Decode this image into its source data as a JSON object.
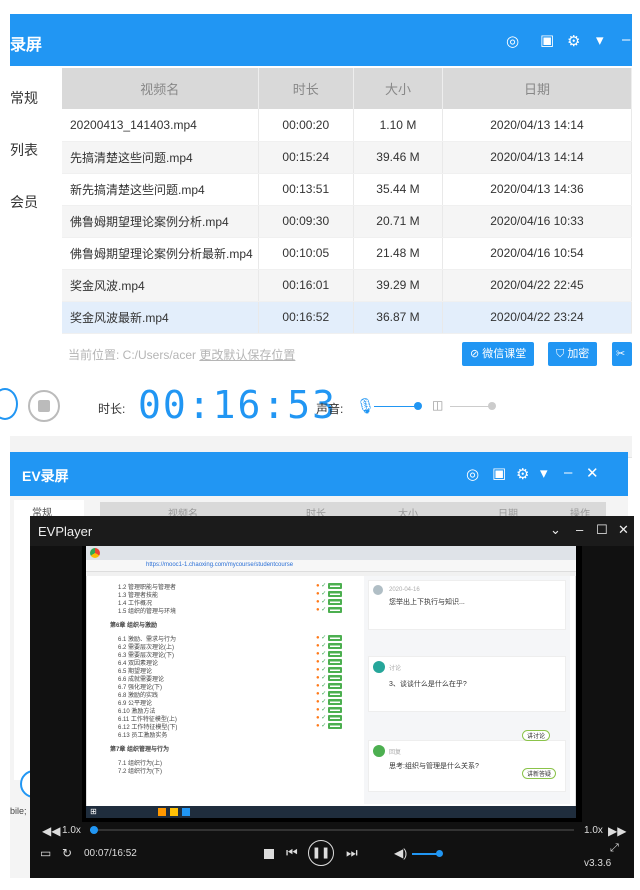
{
  "top_window": {
    "title": "录屏",
    "sidebar": [
      "常规",
      "列表",
      "会员"
    ],
    "table": {
      "headers": [
        "视频名",
        "时长",
        "大小",
        "日期"
      ],
      "rows": [
        {
          "name": "20200413_141403.mp4",
          "duration": "00:00:20",
          "size": "1.10 M",
          "date": "2020/04/13 14:14"
        },
        {
          "name": "先搞清楚这些问题.mp4",
          "duration": "00:15:24",
          "size": "39.46 M",
          "date": "2020/04/13 14:14"
        },
        {
          "name": "新先搞清楚这些问题.mp4",
          "duration": "00:13:51",
          "size": "35.44 M",
          "date": "2020/04/13 14:36"
        },
        {
          "name": "佛鲁姆期望理论案例分析.mp4",
          "duration": "00:09:30",
          "size": "20.71 M",
          "date": "2020/04/16 10:33"
        },
        {
          "name": "佛鲁姆期望理论案例分析最新.mp4",
          "duration": "00:10:05",
          "size": "21.48 M",
          "date": "2020/04/16 10:54"
        },
        {
          "name": "奖金风波.mp4",
          "duration": "00:16:01",
          "size": "39.29 M",
          "date": "2020/04/22 22:45"
        },
        {
          "name": "奖金风波最新.mp4",
          "duration": "00:16:52",
          "size": "36.87 M",
          "date": "2020/04/22 23:24"
        }
      ]
    },
    "path_label": "当前位置: C:/Users/acer",
    "path_link": "更改默认保存位置",
    "wechat_btn": "微信课堂",
    "encrypt_btn": "加密",
    "duration_label": "时长:",
    "timer": "00:16:53",
    "sound_label": "声音:"
  },
  "second_window": {
    "title": "EV录屏",
    "sidebar_item": "常规",
    "headers": [
      "视频名",
      "时长",
      "大小",
      "日期",
      "操作"
    ],
    "bottom_text": "bile;"
  },
  "player": {
    "title": "EVPlayer",
    "speed_left": "1.0x",
    "speed_right": "1.0x",
    "time": "00:07/16:52",
    "version": "v3.3.6",
    "progress": 0.007
  },
  "browser": {
    "url": "https://mooc1-1.chaoxing.com/mycourse/studentcourse",
    "chapters": [
      "1.2 管理职能与管理者",
      "1.3 管理者技能",
      "1.4 工作概况",
      "1.5 组织的管理与环境",
      "第6章 组织与激励",
      "6.1 激励、需求与行为",
      "6.2 需要层次理论(上)",
      "6.3 需要层次理论(下)",
      "6.4 双因素理论",
      "6.5 期望理论",
      "6.6 成就需要理论",
      "6.7 强化理论(下)",
      "6.8 激励的实践",
      "6.9 公平理论",
      "6.10 激励方法",
      "6.11 工作特征模型(上)",
      "6.12 工作特征模型(下)",
      "6.13 员工激励实务",
      "第7章 组织管理与行为",
      "7.1 组织行为(上)",
      "7.2 组织行为(下)"
    ],
    "comments": [
      {
        "text": "您举出上下执行与知识...",
        "sub": "2020-04-16"
      },
      {
        "text": "3、谈谈什么是什么在乎?",
        "sub": "讨论"
      },
      {
        "text": "思考:组织与管理是什么关系?",
        "sub": "回复"
      }
    ],
    "buttons": [
      "讲讨论",
      "讲新答疑"
    ]
  }
}
